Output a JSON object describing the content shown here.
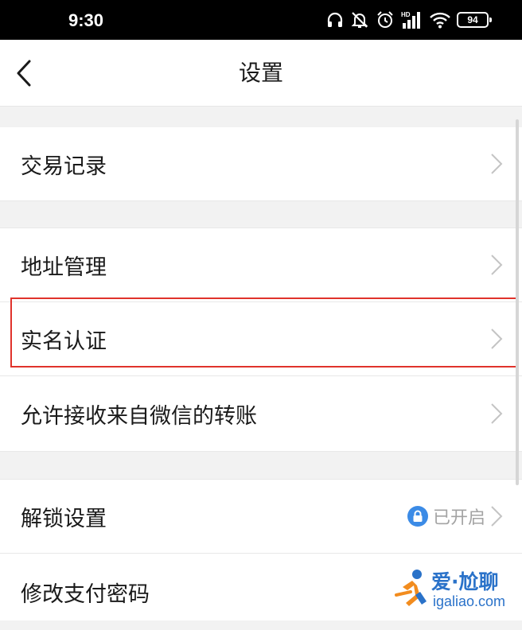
{
  "status_bar": {
    "time": "9:30",
    "battery": "94",
    "network_badge": "HD",
    "icons": [
      "headset-icon",
      "bell-muted-icon",
      "alarm-icon",
      "signal-icon",
      "wifi-icon",
      "battery-icon"
    ]
  },
  "nav": {
    "title": "设置",
    "back_icon": "chevron-left-icon"
  },
  "settings": {
    "transaction_records": "交易记录",
    "address_management": "地址管理",
    "real_name_verification": "实名认证",
    "allow_wechat_transfers": "允许接收来自微信的转账",
    "unlock_settings": "解锁设置",
    "unlock_status": "已开启",
    "change_pay_password": "修改支付密码"
  },
  "watermark": {
    "title": "爱·尬聊",
    "url": "igaliao.com"
  },
  "colors": {
    "highlight_border": "#e0332b",
    "lock_badge": "#3b8be6",
    "watermark": "#2a72c9",
    "section_gap": "#f2f2f2"
  }
}
